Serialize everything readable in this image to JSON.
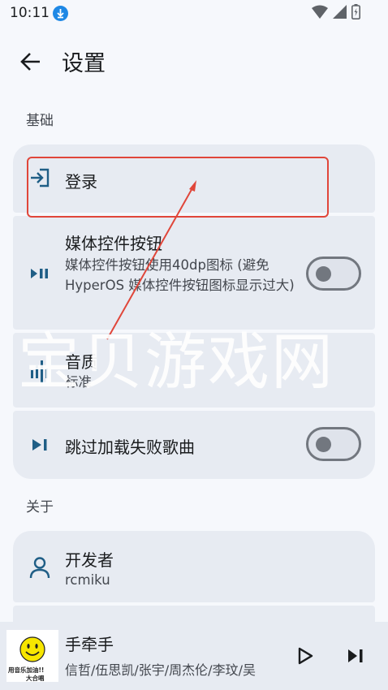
{
  "status_bar": {
    "time": "10:11"
  },
  "header": {
    "title": "设置"
  },
  "sections": {
    "basic": "基础",
    "about": "关于"
  },
  "settings": {
    "login": {
      "title": "登录"
    },
    "media_buttons": {
      "title": "媒体控件按钮",
      "subtitle": "媒体控件按钮使用40dp图标 (避免HyperOS 媒体控件按钮图标显示过大)",
      "enabled": false
    },
    "quality": {
      "title": "音质",
      "value": "标准"
    },
    "skip_failed": {
      "title": "跳过加载失败歌曲",
      "enabled": false
    }
  },
  "about": {
    "developer": {
      "title": "开发者",
      "value": "rcmiku"
    }
  },
  "player": {
    "title": "手牵手",
    "artists": "信哲/伍思凯/张宇/周杰伦/李玟/吴",
    "cover_text_top": "用音乐加油!!",
    "cover_text_bottom": "大合唱"
  },
  "overlay": {
    "watermark": "宝贝游戏网"
  },
  "colors": {
    "background": "#f6f8fc",
    "card": "#e7ebf2",
    "accent": "#1f5e86",
    "highlight": "#e0463a"
  },
  "icons": {
    "back": "arrow-left-icon",
    "login": "login-icon",
    "media": "play-pause-icon",
    "quality": "equalizer-icon",
    "skip": "skip-next-icon",
    "developer": "person-icon",
    "play": "play-icon",
    "next": "skip-next-icon"
  }
}
